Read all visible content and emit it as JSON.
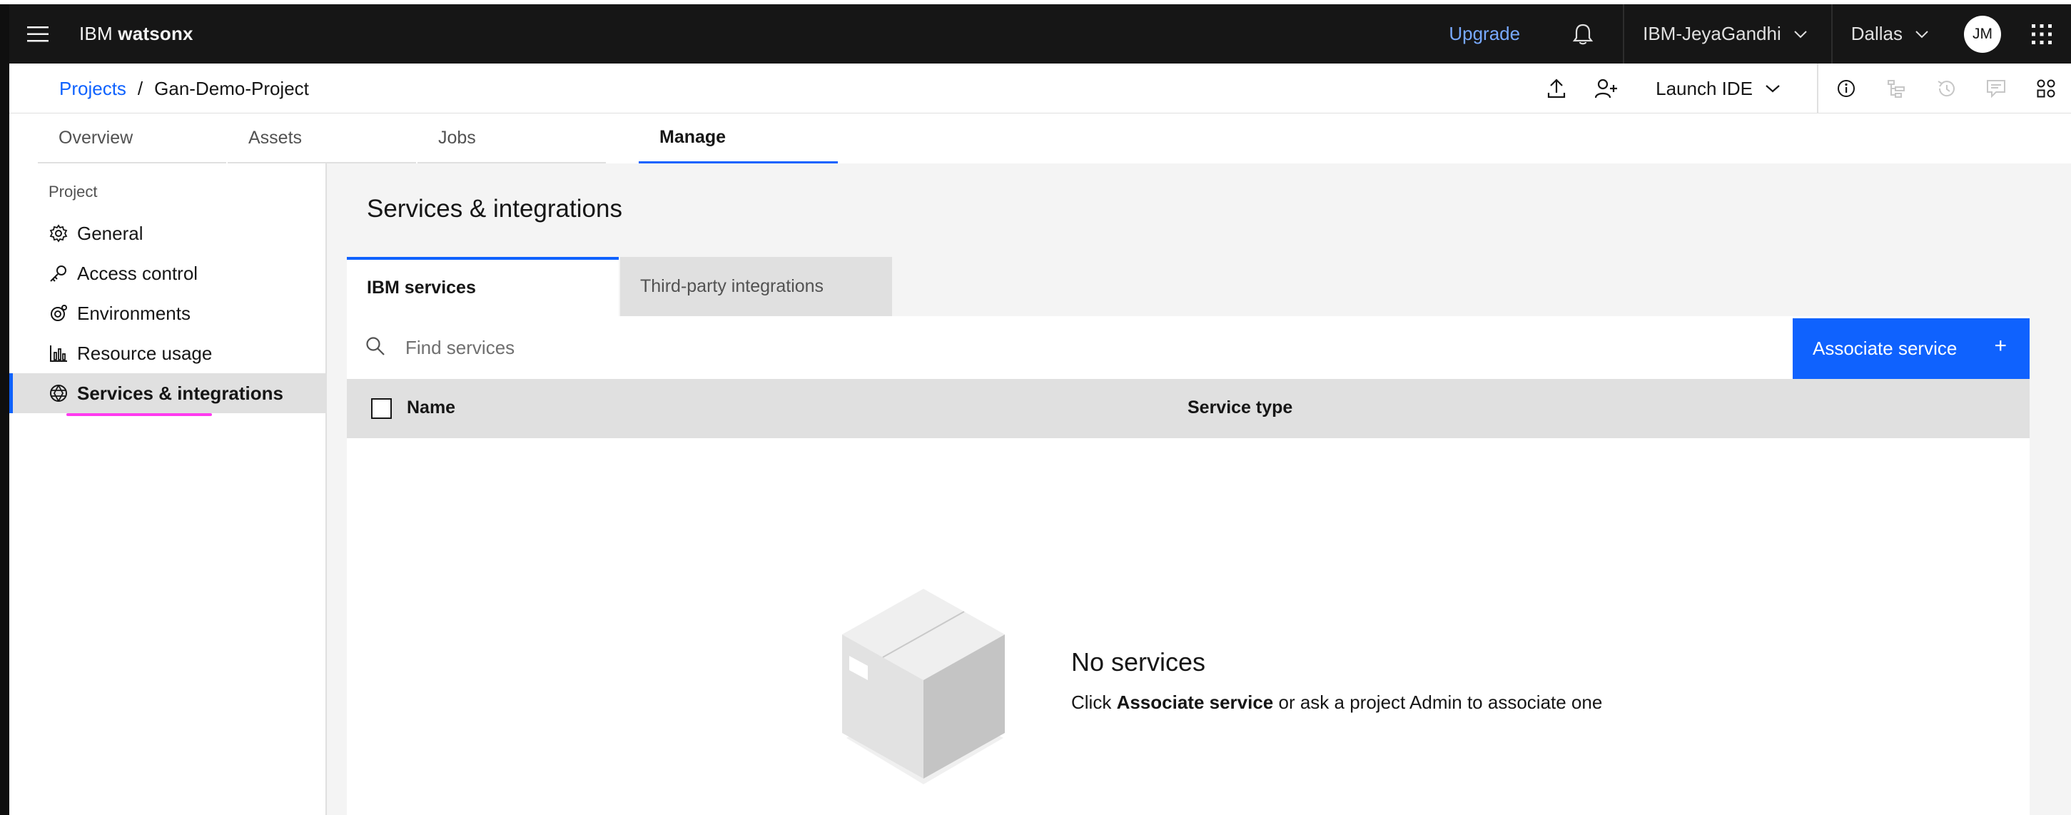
{
  "header": {
    "brand_prefix": "IBM",
    "brand_name": "watsonx",
    "upgrade_label": "Upgrade",
    "account_name": "IBM-JeyaGandhi",
    "region": "Dallas",
    "avatar_initials": "JM"
  },
  "breadcrumb": {
    "root": "Projects",
    "separator": "/",
    "current": "Gan-Demo-Project",
    "launch_label": "Launch IDE"
  },
  "tabs": [
    {
      "label": "Overview"
    },
    {
      "label": "Assets"
    },
    {
      "label": "Jobs"
    },
    {
      "label": "Manage",
      "active": true
    }
  ],
  "sidenav": {
    "heading": "Project",
    "items": [
      {
        "label": "General",
        "icon": "gear-icon"
      },
      {
        "label": "Access control",
        "icon": "key-icon"
      },
      {
        "label": "Environments",
        "icon": "environment-icon"
      },
      {
        "label": "Resource usage",
        "icon": "chart-bar-icon"
      },
      {
        "label": "Services & integrations",
        "icon": "services-icon",
        "active": true
      }
    ]
  },
  "content": {
    "title": "Services & integrations",
    "subtabs": [
      {
        "label": "IBM services",
        "active": true
      },
      {
        "label": "Third-party integrations"
      }
    ],
    "search_placeholder": "Find services",
    "associate_label": "Associate service",
    "columns": [
      "Name",
      "Service type"
    ],
    "empty_title": "No services",
    "empty_prefix": "Click ",
    "empty_bold": "Associate service",
    "empty_suffix": " or ask a project Admin to associate one"
  },
  "colors": {
    "accent": "#0f62fe",
    "highlight": "#ff3bef",
    "header_bg": "#161616",
    "upgrade": "#78a9ff"
  }
}
